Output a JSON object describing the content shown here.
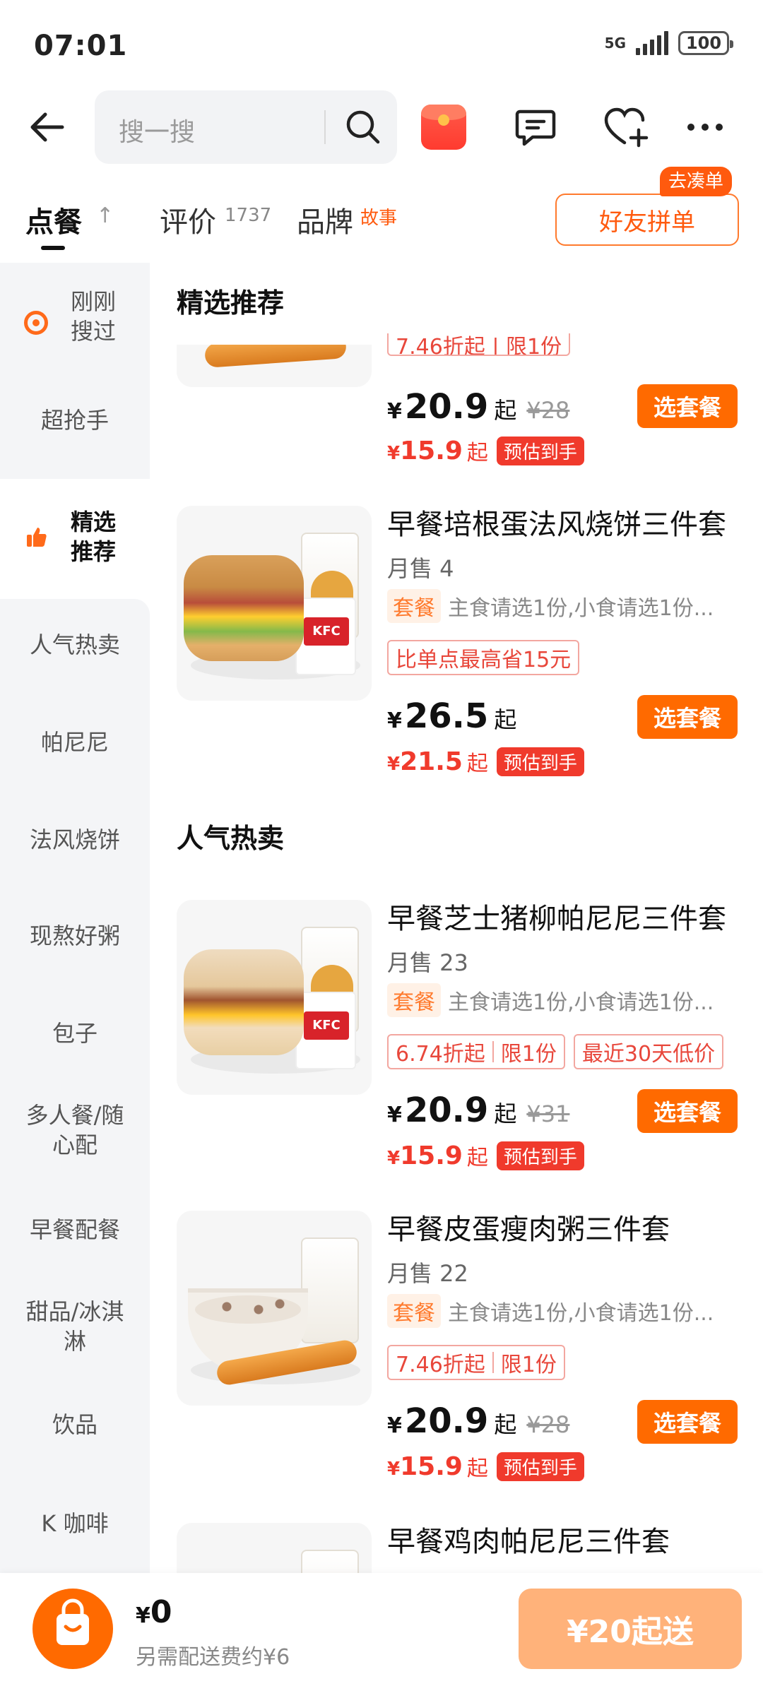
{
  "status_bar": {
    "time": "07:01",
    "network": "5G",
    "battery": "100"
  },
  "header": {
    "search_placeholder": "搜一搜"
  },
  "tabs": {
    "order": "点餐",
    "order_arrow": "↑",
    "review": "评价",
    "review_count": "1737",
    "brand": "品牌",
    "brand_sub": "故事",
    "friend_button": "好友拼单",
    "friend_badge": "去凑单"
  },
  "sidebar": {
    "items": [
      {
        "label": "刚刚\n搜过"
      },
      {
        "label": "超抢手"
      },
      {
        "label": "精选\n推荐"
      },
      {
        "label": "人气热卖"
      },
      {
        "label": "帕尼尼"
      },
      {
        "label": "法风烧饼"
      },
      {
        "label": "现熬好粥"
      },
      {
        "label": "包子"
      },
      {
        "label": "多人餐/随\n心配"
      },
      {
        "label": "早餐配餐"
      },
      {
        "label": "甜品/冰淇\n淋"
      },
      {
        "label": "饮品"
      },
      {
        "label": "K 咖啡"
      }
    ]
  },
  "sections": {
    "featured": "精选推荐",
    "popular": "人气热卖"
  },
  "partial_item": {
    "promo": "7.46折起 | 限1份",
    "price": "20.9",
    "price_suffix": "起",
    "orig_price": "¥28",
    "est_price": "15.9",
    "est_suffix": "起",
    "est_badge": "预估到手",
    "button": "选套餐"
  },
  "items": [
    {
      "name": "早餐培根蛋法风烧饼三件套",
      "sales": "月售 4",
      "combo_tag": "套餐",
      "combo_desc": "主食请选1份,小食请选1份...",
      "promos": [
        {
          "a": "比单点最高省15元"
        }
      ],
      "price": "26.5",
      "price_suffix": "起",
      "orig_price": "",
      "est_price": "21.5",
      "est_suffix": "起",
      "est_badge": "预估到手",
      "button": "选套餐"
    },
    {
      "name": "早餐芝士猪柳帕尼尼三件套",
      "sales": "月售 23",
      "combo_tag": "套餐",
      "combo_desc": "主食请选1份,小食请选1份...",
      "promos": [
        {
          "a": "6.74折起",
          "b": "限1份"
        },
        {
          "a": "最近30天低价"
        }
      ],
      "price": "20.9",
      "price_suffix": "起",
      "orig_price": "¥31",
      "est_price": "15.9",
      "est_suffix": "起",
      "est_badge": "预估到手",
      "button": "选套餐"
    },
    {
      "name": "早餐皮蛋瘦肉粥三件套",
      "sales": "月售 22",
      "combo_tag": "套餐",
      "combo_desc": "主食请选1份,小食请选1份...",
      "promos": [
        {
          "a": "7.46折起",
          "b": "限1份"
        }
      ],
      "price": "20.9",
      "price_suffix": "起",
      "orig_price": "¥28",
      "est_price": "15.9",
      "est_suffix": "起",
      "est_badge": "预估到手",
      "button": "选套餐"
    },
    {
      "name": "早餐鸡肉帕尼尼三件套"
    }
  ],
  "bottom_bar": {
    "currency": "¥",
    "total": "0",
    "delivery_note": "另需配送费约¥6",
    "checkout": "¥20起送"
  },
  "colors": {
    "accent": "#ff6a00",
    "price_red": "#f03a2c",
    "checkout_disabled": "#ffb27a"
  }
}
